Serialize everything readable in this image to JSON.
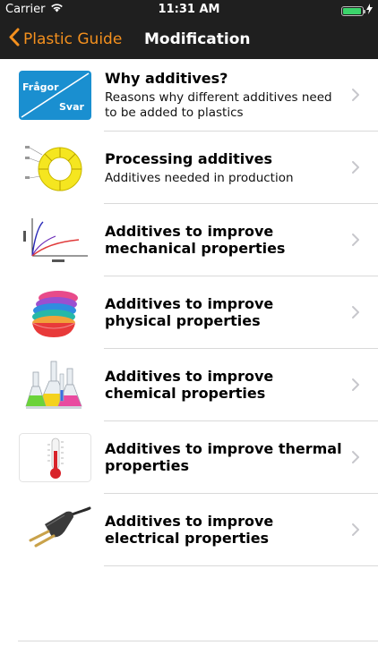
{
  "status_bar": {
    "carrier": "Carrier",
    "time": "11:31 AM"
  },
  "nav": {
    "back_label": "Plastic Guide",
    "title": "Modification"
  },
  "thumb_faq": {
    "top": "Frågor",
    "bottom": "Svar"
  },
  "items": [
    {
      "title": "Why additives?",
      "subtitle": "Reasons why different additives need to be added to plastics",
      "icon": "question-answer-icon"
    },
    {
      "title": "Processing additives",
      "subtitle": "Additives needed in production",
      "icon": "process-diagram-icon"
    },
    {
      "title": "Additives to improve mechanical properties",
      "subtitle": "",
      "icon": "stress-strain-chart-icon"
    },
    {
      "title": "Additives to improve physical properties",
      "subtitle": "",
      "icon": "colored-bowls-icon"
    },
    {
      "title": "Additives to improve chemical properties",
      "subtitle": "",
      "icon": "flasks-icon"
    },
    {
      "title": "Additives to improve thermal properties",
      "subtitle": "",
      "icon": "thermometer-icon"
    },
    {
      "title": "Additives to improve electrical properties",
      "subtitle": "",
      "icon": "electric-plug-icon"
    }
  ],
  "colors": {
    "accent": "#f4901e",
    "nav_bg": "#1f1f1f",
    "faq_blue": "#1a8fd0"
  }
}
